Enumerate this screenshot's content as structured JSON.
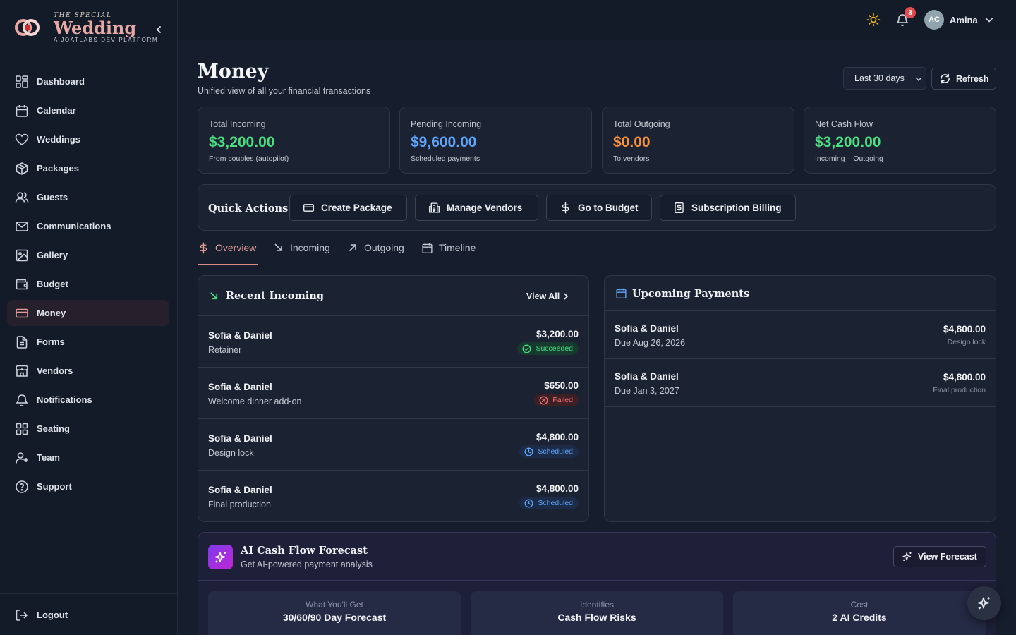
{
  "brand": {
    "small": "THE SPECIAL",
    "name": "Wedding",
    "tagline": "A JOATLABS.DEV PLATFORM"
  },
  "sidebar": {
    "items": [
      {
        "label": "Dashboard",
        "icon": "grid-icon"
      },
      {
        "label": "Calendar",
        "icon": "calendar-icon"
      },
      {
        "label": "Weddings",
        "icon": "heart-icon"
      },
      {
        "label": "Packages",
        "icon": "package-icon"
      },
      {
        "label": "Guests",
        "icon": "users-icon"
      },
      {
        "label": "Communications",
        "icon": "mail-icon"
      },
      {
        "label": "Gallery",
        "icon": "image-icon"
      },
      {
        "label": "Budget",
        "icon": "wallet-icon"
      },
      {
        "label": "Money",
        "icon": "credit-card-icon",
        "active": true
      },
      {
        "label": "Forms",
        "icon": "file-text-icon"
      },
      {
        "label": "Vendors",
        "icon": "store-icon"
      },
      {
        "label": "Notifications",
        "icon": "bell-icon"
      },
      {
        "label": "Seating",
        "icon": "layout-grid-icon"
      },
      {
        "label": "Team",
        "icon": "user-plus-icon"
      },
      {
        "label": "Support",
        "icon": "help-circle-icon"
      }
    ],
    "logout": "Logout"
  },
  "topbar": {
    "notification_count": "3",
    "avatar_initials": "AC",
    "user_name": "Amina"
  },
  "header": {
    "title": "Money",
    "subtitle": "Unified view of all your financial transactions",
    "range": "Last 30 days",
    "refresh": "Refresh"
  },
  "stats": [
    {
      "label": "Total Incoming",
      "value": "$3,200.00",
      "note": "From couples (autopilot)",
      "color": "#4ade80"
    },
    {
      "label": "Pending Incoming",
      "value": "$9,600.00",
      "note": "Scheduled payments",
      "color": "#60a5fa"
    },
    {
      "label": "Total Outgoing",
      "value": "$0.00",
      "note": "To vendors",
      "color": "#fb923c"
    },
    {
      "label": "Net Cash Flow",
      "value": "$3,200.00",
      "note": "Incoming – Outgoing",
      "color": "#4ade80"
    }
  ],
  "quick_actions": {
    "title": "Quick Actions",
    "buttons": [
      "Create Package",
      "Manage Vendors",
      "Go to Budget",
      "Subscription Billing"
    ]
  },
  "tabs": [
    "Overview",
    "Incoming",
    "Outgoing",
    "Timeline"
  ],
  "recent_incoming": {
    "title": "Recent Incoming",
    "view_all": "View All",
    "rows": [
      {
        "name": "Sofia & Daniel",
        "desc": "Retainer",
        "amount": "$3,200.00",
        "status": "Succeeded"
      },
      {
        "name": "Sofia & Daniel",
        "desc": "Welcome dinner add-on",
        "amount": "$650.00",
        "status": "Failed"
      },
      {
        "name": "Sofia & Daniel",
        "desc": "Design lock",
        "amount": "$4,800.00",
        "status": "Scheduled"
      },
      {
        "name": "Sofia & Daniel",
        "desc": "Final production",
        "amount": "$4,800.00",
        "status": "Scheduled"
      }
    ]
  },
  "upcoming": {
    "title": "Upcoming Payments",
    "rows": [
      {
        "name": "Sofia & Daniel",
        "due": "Due Aug 26, 2026",
        "amount": "$4,800.00",
        "label": "Design lock"
      },
      {
        "name": "Sofia & Daniel",
        "due": "Due Jan 3, 2027",
        "amount": "$4,800.00",
        "label": "Final production"
      }
    ]
  },
  "ai": {
    "title": "AI Cash Flow Forecast",
    "subtitle": "Get AI-powered payment analysis",
    "button": "View Forecast",
    "cards": [
      {
        "k": "What You'll Get",
        "v": "30/60/90 Day Forecast"
      },
      {
        "k": "Identifies",
        "v": "Cash Flow Risks"
      },
      {
        "k": "Cost",
        "v": "2 AI Credits"
      }
    ]
  }
}
